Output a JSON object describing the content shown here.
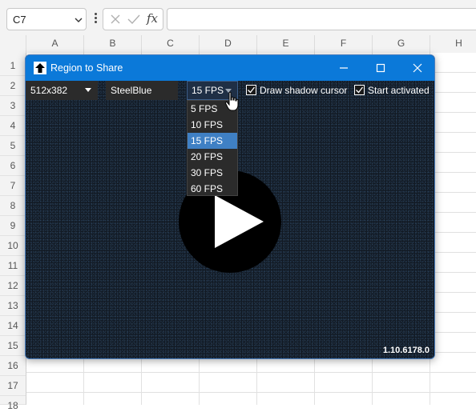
{
  "formula_bar": {
    "name_box": "C7",
    "cancel_icon": "x-icon",
    "enter_icon": "check-icon",
    "fx_label": "fx",
    "formula": ""
  },
  "sheet": {
    "columns": [
      "A",
      "B",
      "C",
      "D",
      "E",
      "F",
      "G",
      "H"
    ],
    "rows": [
      "1",
      "2",
      "3",
      "4",
      "5",
      "6",
      "7",
      "8",
      "9",
      "10",
      "11",
      "12",
      "13",
      "14",
      "15",
      "16",
      "17",
      "18"
    ]
  },
  "window": {
    "title": "Region to Share",
    "app_icon": "upload-arrow-icon",
    "buttons": [
      "minimize-icon",
      "maximize-icon",
      "close-icon"
    ],
    "resolution": "512x382",
    "color": "SteelBlue",
    "fps_value": "15 FPS",
    "fps_options": [
      "5 FPS",
      "10 FPS",
      "15 FPS",
      "20 FPS",
      "30 FPS",
      "60 FPS"
    ],
    "fps_selected_index": 2,
    "draw_shadow_cursor": {
      "label": "Draw shadow cursor",
      "checked": true
    },
    "start_activated": {
      "label": "Start activated",
      "checked": true
    },
    "version": "1.10.6178.0",
    "play_icon": "play-icon",
    "accent": "#0b79d9",
    "selection_color": "#3f80c4"
  }
}
